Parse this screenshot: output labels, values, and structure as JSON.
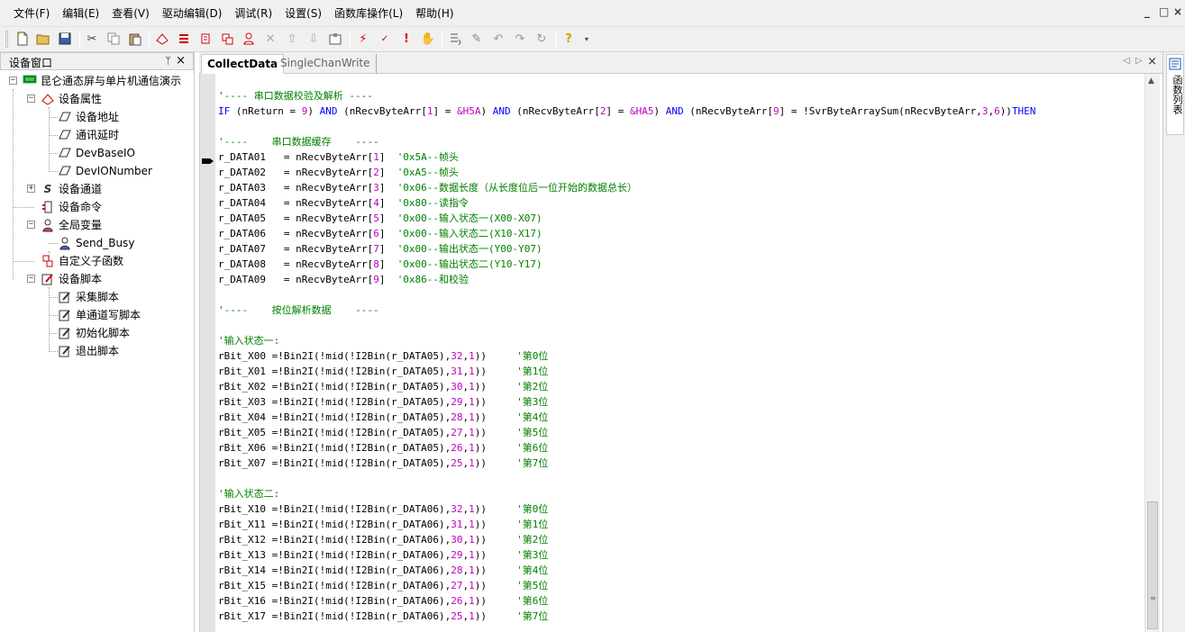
{
  "menu": {
    "items": [
      "文件(F)",
      "编辑(E)",
      "查看(V)",
      "驱动编辑(D)",
      "调试(R)",
      "设置(S)",
      "函数库操作(L)",
      "帮助(H)"
    ],
    "window_controls": [
      "_",
      "□",
      "×"
    ]
  },
  "toolbar": {
    "buttons": [
      "new-file-icon",
      "open-folder-icon",
      "save-icon",
      "cut-icon",
      "copy-icon",
      "paste-icon",
      "device-add-icon",
      "device-channel-icon",
      "device-command-icon",
      "device-variable-icon",
      "device-user-icon",
      "delete-icon",
      "move-up-icon",
      "move-down-icon",
      "properties-icon",
      "compile-icon",
      "debug-icon",
      "stop-icon",
      "hand-icon",
      "step-icon",
      "edit-icon",
      "undo-icon",
      "redo-icon",
      "loop-icon",
      "help-icon"
    ]
  },
  "device_panel": {
    "title": "设备窗口",
    "pin_glyph": "ᛘ",
    "close_glyph": "×",
    "tree": {
      "root": "昆仑通态屏与单片机通信演示",
      "properties": "设备属性",
      "properties_children": [
        "设备地址",
        "通讯延时",
        "DevBaseIO",
        "DevIONumber"
      ],
      "channel": "设备通道",
      "command": "设备命令",
      "globals": "全局变量",
      "globals_children": [
        "Send_Busy"
      ],
      "subfunctions": "自定义子函数",
      "scripts": "设备脚本",
      "scripts_children": [
        "采集脚本",
        "单通道写脚本",
        "初始化脚本",
        "退出脚本"
      ]
    }
  },
  "editor": {
    "tabs": [
      "CollectData",
      "SingleChanWrite"
    ],
    "close_glyph": "×",
    "code": [
      {
        "t": "'---- 串口数据校验及解析 ----",
        "k": "cm"
      },
      {
        "t": "IF (nReturn = 9) AND (nRecvByteArr[1] = &H5A) AND (nRecvByteArr[2] = &HA5) AND (nRecvByteArr[9] = !SvrByteArraySum(nRecvByteArr,3,6))THEN",
        "k": "if"
      },
      {
        "t": "",
        "k": "blank"
      },
      {
        "t": "'----    串口数据缓存    ----",
        "k": "cm"
      },
      {
        "t": "r_DATA01   = nRecvByteArr[1]  '0x5A--帧头",
        "k": "assign",
        "idx": "1"
      },
      {
        "t": "r_DATA02   = nRecvByteArr[2]  '0xA5--帧头",
        "k": "assign",
        "idx": "2"
      },
      {
        "t": "r_DATA03   = nRecvByteArr[3]  '0x06--数据长度（从长度位后一位开始的数据总长）",
        "k": "assign",
        "idx": "3"
      },
      {
        "t": "r_DATA04   = nRecvByteArr[4]  '0x80--读指令",
        "k": "assign",
        "idx": "4"
      },
      {
        "t": "r_DATA05   = nRecvByteArr[5]  '0x00--输入状态一(X00-X07)",
        "k": "assign",
        "idx": "5"
      },
      {
        "t": "r_DATA06   = nRecvByteArr[6]  '0x00--输入状态二(X10-X17)",
        "k": "assign",
        "idx": "6"
      },
      {
        "t": "r_DATA07   = nRecvByteArr[7]  '0x00--输出状态一(Y00-Y07)",
        "k": "assign",
        "idx": "7"
      },
      {
        "t": "r_DATA08   = nRecvByteArr[8]  '0x00--输出状态二(Y10-Y17)",
        "k": "assign",
        "idx": "8"
      },
      {
        "t": "r_DATA09   = nRecvByteArr[9]  '0x86--和校验",
        "k": "assign",
        "idx": "9"
      },
      {
        "t": "",
        "k": "blank"
      },
      {
        "t": "'----    按位解析数据    ----",
        "k": "cm"
      },
      {
        "t": "",
        "k": "blank"
      },
      {
        "t": "'输入状态一:",
        "k": "cm"
      },
      {
        "t": "rBit_X00 =!Bin2I(!mid(!I2Bin(r_DATA05),32,1))     '第0位",
        "k": "bit",
        "a": "32"
      },
      {
        "t": "rBit_X01 =!Bin2I(!mid(!I2Bin(r_DATA05),31,1))     '第1位",
        "k": "bit",
        "a": "31"
      },
      {
        "t": "rBit_X02 =!Bin2I(!mid(!I2Bin(r_DATA05),30,1))     '第2位",
        "k": "bit",
        "a": "30"
      },
      {
        "t": "rBit_X03 =!Bin2I(!mid(!I2Bin(r_DATA05),29,1))     '第3位",
        "k": "bit",
        "a": "29"
      },
      {
        "t": "rBit_X04 =!Bin2I(!mid(!I2Bin(r_DATA05),28,1))     '第4位",
        "k": "bit",
        "a": "28"
      },
      {
        "t": "rBit_X05 =!Bin2I(!mid(!I2Bin(r_DATA05),27,1))     '第5位",
        "k": "bit",
        "a": "27"
      },
      {
        "t": "rBit_X06 =!Bin2I(!mid(!I2Bin(r_DATA05),26,1))     '第6位",
        "k": "bit",
        "a": "26"
      },
      {
        "t": "rBit_X07 =!Bin2I(!mid(!I2Bin(r_DATA05),25,1))     '第7位",
        "k": "bit",
        "a": "25"
      },
      {
        "t": "",
        "k": "blank"
      },
      {
        "t": "'输入状态二:",
        "k": "cm"
      },
      {
        "t": "rBit_X10 =!Bin2I(!mid(!I2Bin(r_DATA06),32,1))     '第0位",
        "k": "bit",
        "a": "32"
      },
      {
        "t": "rBit_X11 =!Bin2I(!mid(!I2Bin(r_DATA06),31,1))     '第1位",
        "k": "bit",
        "a": "31"
      },
      {
        "t": "rBit_X12 =!Bin2I(!mid(!I2Bin(r_DATA06),30,1))     '第2位",
        "k": "bit",
        "a": "30"
      },
      {
        "t": "rBit_X13 =!Bin2I(!mid(!I2Bin(r_DATA06),29,1))     '第3位",
        "k": "bit",
        "a": "29"
      },
      {
        "t": "rBit_X14 =!Bin2I(!mid(!I2Bin(r_DATA06),28,1))     '第4位",
        "k": "bit",
        "a": "28"
      },
      {
        "t": "rBit_X15 =!Bin2I(!mid(!I2Bin(r_DATA06),27,1))     '第5位",
        "k": "bit",
        "a": "27"
      },
      {
        "t": "rBit_X16 =!Bin2I(!mid(!I2Bin(r_DATA06),26,1))     '第6位",
        "k": "bit",
        "a": "26"
      },
      {
        "t": "rBit_X17 =!Bin2I(!mid(!I2Bin(r_DATA06),25,1))     '第7位",
        "k": "bit",
        "a": "25"
      }
    ]
  },
  "function_list": {
    "label": "函数列表"
  },
  "colors": {
    "keyword": "#0000ff",
    "comment": "#008000",
    "number": "#c000c0"
  }
}
